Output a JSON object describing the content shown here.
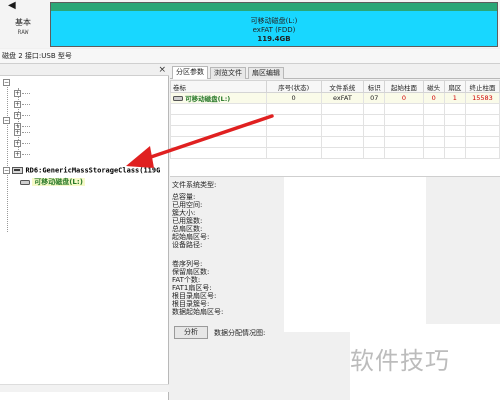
{
  "disk_header": {
    "kind_label": "基本",
    "kind_sub": "RAW",
    "partition": {
      "name": "可移动磁盘(L:)",
      "fs": "exFAT (FDD)",
      "size": "119.4GB"
    },
    "colors": {
      "partition_fill": "#18d7ff",
      "partition_band": "#2aa777"
    }
  },
  "disk_info_bar": {
    "text": "磁盘 2 接口:USB  型号"
  },
  "tree": {
    "disk_node_label": "RD6:GenericMassStorageClass(119G",
    "partition_node_label": "可移动磁盘(L:)",
    "close_glyph": "×"
  },
  "tabs": [
    {
      "label": "分区参数"
    },
    {
      "label": "浏览文件"
    },
    {
      "label": "扇区编辑"
    }
  ],
  "table": {
    "headers": [
      "卷标",
      "序号(状态)",
      "文件系统",
      "标识",
      "起始柱面",
      "磁头",
      "扇区",
      "终止柱面"
    ],
    "rows": [
      {
        "label": "可移动磁盘(L:)",
        "index": "0",
        "fs": "exFAT",
        "id": "07",
        "start_cyl": "0",
        "head": "0",
        "sector": "1",
        "end_cyl": "15583"
      }
    ]
  },
  "fs_info": {
    "group1": [
      "文件系统类型:",
      "总容量:",
      "已用空间:",
      "簇大小:",
      "已用簇数:",
      "总扇区数:",
      "起始扇区号:",
      "设备路径:"
    ],
    "group2": [
      "卷序列号:",
      "保留扇区数:",
      "FAT个数:",
      "FAT1扇区号:",
      "根目录扇区号:",
      "根目录簇号:",
      "数据起始扇区号:"
    ]
  },
  "analyze": {
    "button_label": "分析",
    "label": "数据分配情况图:"
  },
  "watermark": "软件技巧",
  "annotation": {
    "color": "#e02020"
  }
}
